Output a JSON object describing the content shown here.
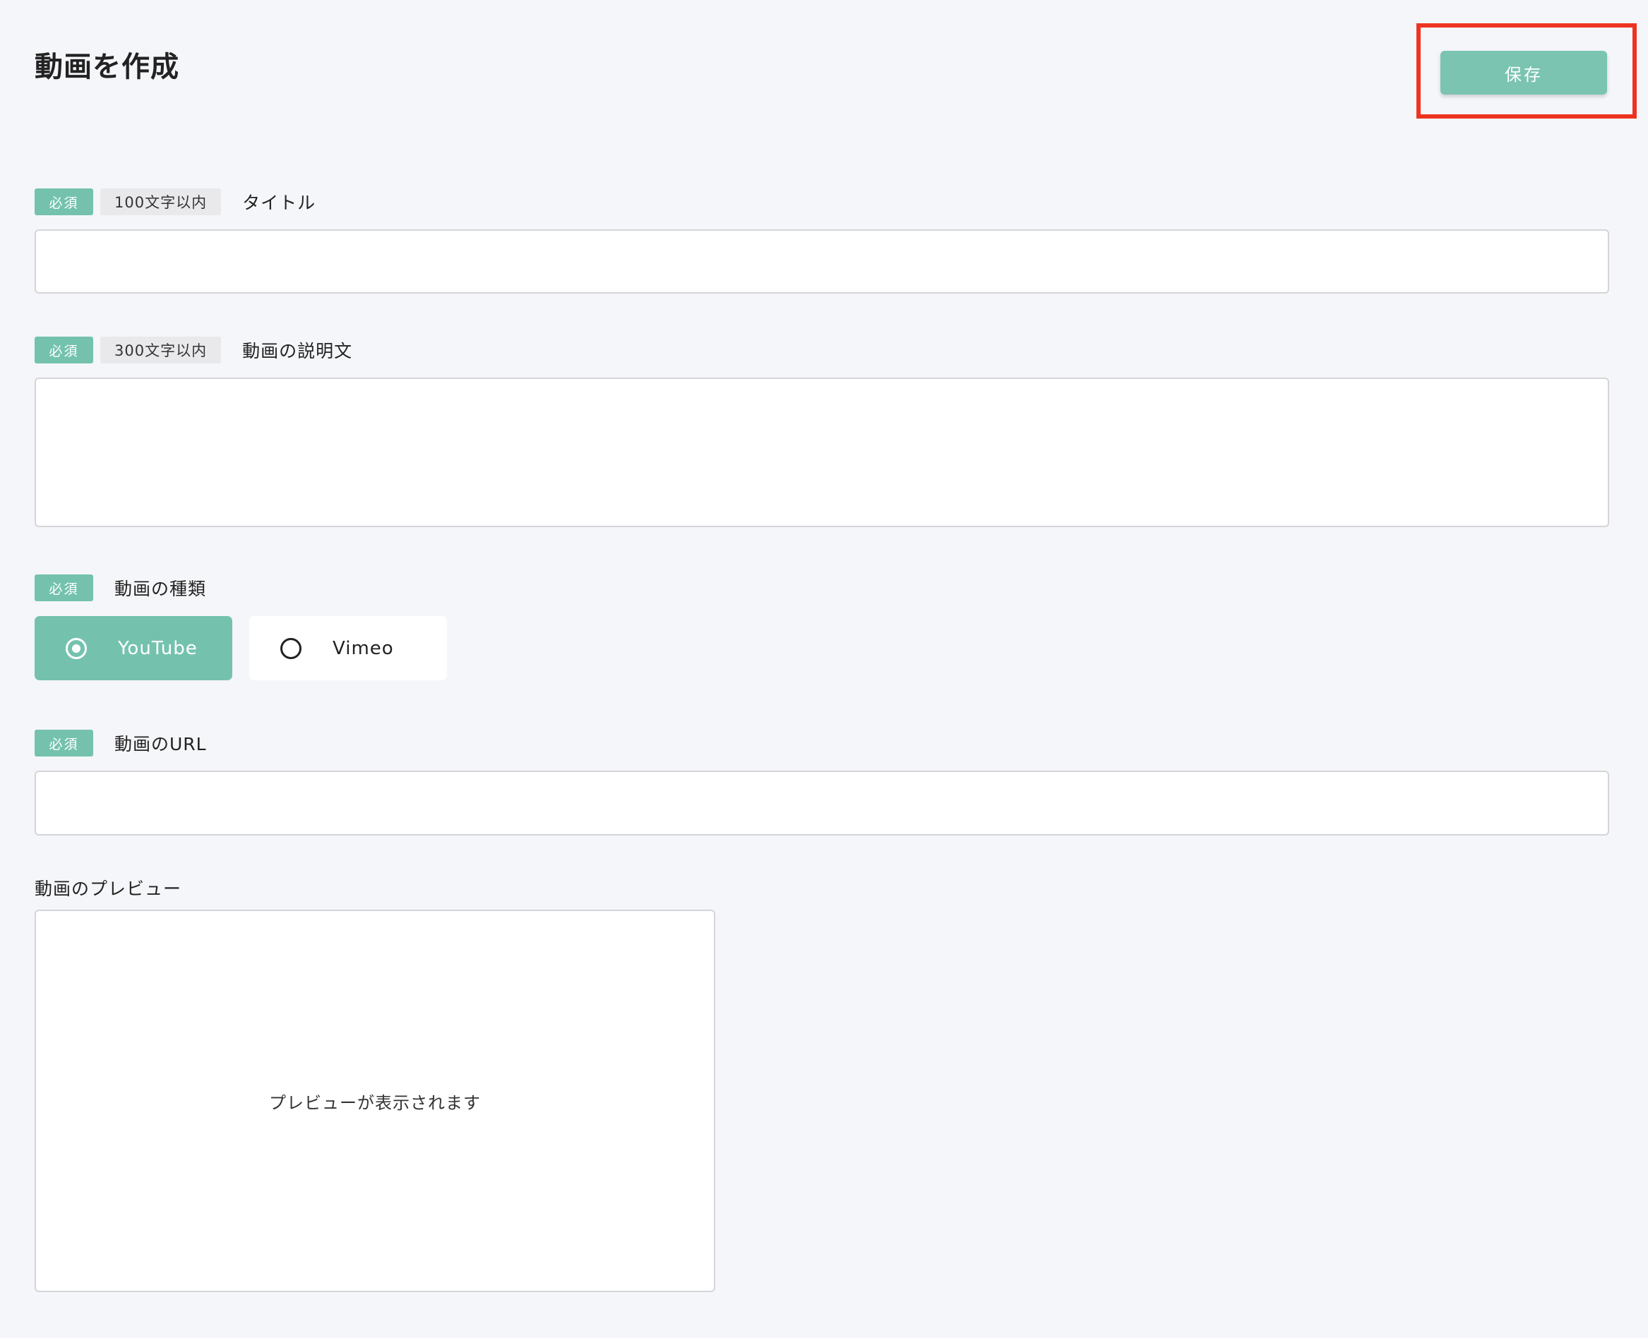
{
  "page": {
    "title": "動画を作成"
  },
  "header": {
    "save_label": "保存"
  },
  "form": {
    "title_field": {
      "required_badge": "必須",
      "limit_badge": "100文字以内",
      "label": "タイトル",
      "value": ""
    },
    "description_field": {
      "required_badge": "必須",
      "limit_badge": "300文字以内",
      "label": "動画の説明文",
      "value": ""
    },
    "video_type_field": {
      "required_badge": "必須",
      "label": "動画の種類",
      "options": [
        {
          "label": "YouTube",
          "selected": true
        },
        {
          "label": "Vimeo",
          "selected": false
        }
      ]
    },
    "url_field": {
      "required_badge": "必須",
      "label": "動画のURL",
      "value": ""
    },
    "preview": {
      "label": "動画のプレビュー",
      "placeholder": "プレビューが表示されます"
    }
  },
  "colors": {
    "accent": "#74c2ae",
    "highlight_border": "#ee3322",
    "background": "#f5f6f9"
  }
}
